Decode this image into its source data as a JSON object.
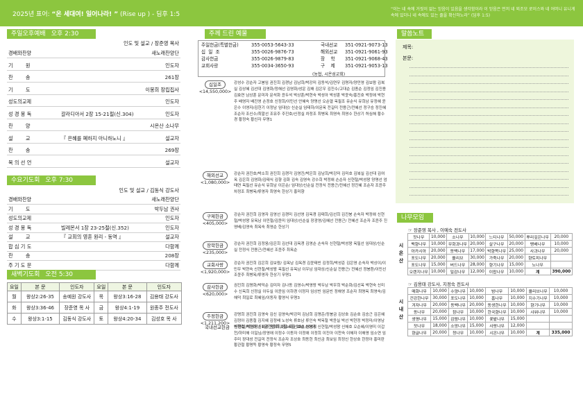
{
  "top": {
    "year_motto_prefix": "2025년 표어: ",
    "motto": "“온 세대여! 일어나라! ”",
    "motto_sub": " (Rise up ) - 딤후 1:5",
    "verse": "“이는 네 속에 거짓이 없는 믿음이 있음을 생각함이라 이 믿음은 먼저 네 외조모 로이스와 네 어머니 유니게 속에 있더니 네 속에도 있는 줄을 확신하노라” (딤후 1:5)"
  },
  "sunday": {
    "title": "주일오후예배",
    "time": "오후 2:30",
    "leader": "인도 및 설교 / 장준영 목사",
    "rows": [
      {
        "k": "경배와찬양",
        "m": "",
        "v": "새노래찬양단"
      },
      {
        "k": "기        원",
        "m": "",
        "v": "인도자"
      },
      {
        "k": "찬        송",
        "m": "",
        "v": "261장"
      },
      {
        "k": "기        도",
        "m": "",
        "v": "이봉희 장립집사"
      },
      {
        "k": "성도의교제",
        "m": "",
        "v": "인도자"
      },
      {
        "k": "성 경 봉 독",
        "m": "갈라디아서 2장 15-21절(신.304)",
        "v": "인도자"
      },
      {
        "k": "찬        양",
        "m": "",
        "v": "시온산 소나무"
      },
      {
        "k": "설        교",
        "m": "『 은혜를 폐하지 아니하노니 』",
        "v": "설교자"
      },
      {
        "k": "찬        송",
        "m": "",
        "v": "269장"
      },
      {
        "k": "복 의 선 언",
        "m": "",
        "v": "설교자"
      }
    ]
  },
  "wednesday": {
    "title": "수요기도회",
    "time": "오후 7:30",
    "leader": "인도 및 설교 / 김동식 강도사",
    "rows": [
      {
        "k": "경배와찬양",
        "m": "",
        "v": "새노래찬양단"
      },
      {
        "k": "기        도",
        "m": "",
        "v": "박두남 권사"
      },
      {
        "k": "성도의교제",
        "m": "",
        "v": "인도자"
      },
      {
        "k": "성 경 봉 독",
        "m": "빌레몬서 1장 23-25절(신.352)",
        "v": "인도자"
      },
      {
        "k": "설        교",
        "m": "『 교회의 영혼 원리 - 동역 』",
        "v": "설교자"
      },
      {
        "k": "합 심 기 도",
        "m": "",
        "v": "다함께"
      },
      {
        "k": "찬        송",
        "m": "",
        "v": "208장"
      },
      {
        "k": "주 기 도 문",
        "m": "",
        "v": "다함께"
      }
    ]
  },
  "dawn": {
    "title": "새벽기도회",
    "time": "오전 5:30",
    "head": [
      "요일",
      "본    문",
      "인도자",
      "요일",
      "본    문",
      "인도자"
    ],
    "rows": [
      [
        "월",
        "왕상2:26-35",
        "송예원 강도사",
        "목",
        "왕상3:16-28",
        "김용태 강도사"
      ],
      [
        "화",
        "왕상3:36-46",
        "장준영 목 사",
        "금",
        "왕상4:1-19",
        "원종주 전도사"
      ],
      [
        "수",
        "왕상3:1-15",
        "김동식 강도사",
        "토",
        "왕상4:20-34",
        "김성호 목 사"
      ]
    ]
  },
  "offering": {
    "title": "주께 드린 예물",
    "accounts": [
      {
        "k": "주일헌금(특별헌금)",
        "v": "355-0053-5643-33",
        "k2": "국내선교",
        "v2": "351-0921-9073-13"
      },
      {
        "k": "십  일  조",
        "v": "355-0026-9876-73",
        "k2": "해외선교",
        "v2": "351-0921-9061-93"
      },
      {
        "k": "감사헌금",
        "v": "355-0026-9879-83",
        "k2": "장    학",
        "v2": "351-0921-9068-43"
      },
      {
        "k": "교회사랑",
        "v": "355-0034-3650-93",
        "k2": "구    제",
        "v2": "351-0921-9053-13"
      }
    ],
    "bank": "(농협, 시온성교회)",
    "cats": [
      {
        "name": "십일조",
        "amt": "<14,550,000>",
        "names": "강성수 강순자 고봉임 권진희 김경남 김남희/박강미 김동석/김연우 김명자/양민영 김보람 김복실 김상혜 김선대 김영화/정해선 김영화/성운 김해 김은우 김진수/고대순 김종순 김정임 김진용 김효연 남상훈 문미자 문석화 윤두석 박상훈/박현숙 박성아 박성훈 박윤숙/홍진호 박정애 박현주 배영자 배진영 손정호 신정희/이민선 안혜숙 양명선 오순열 옥필조 유순식 유희남 유정혜 윤은수 이영자/김헌기 이정남 임대상/ 신순실 임태하/이문옥 전길미 전용근/전혜선 정구승 정진혜 조순자 조신수/최말선 조유주 주진호/신정실 차정조 최병옥 최영숙 최영수 한상기 허심해 황수경 황정숙 황신자 무명1",
        "lines": 14
      },
      {
        "name": "해외선교",
        "amt": "<1,080,000>",
        "names": "강순자 권진호/박소희 권진희 김경각 김영진/박은희 김남희/박강미 김미호 김복실 김선대 김여옥 김은희 김영화/김태식 김향 김화 김숙 김영숙 강수희 박정애 손순자 신현철/박성왕 양명선 엄태연 옥필선 유순식 유희남 이은순/ 임대상/신순실 전정식 전용근/전혜선 정진혜 조순자 조윤주 차정조 최병옥/류영자 최영숙 한상기 홍미향",
        "lines": 6
      },
      {
        "name": "구제헌금",
        "amt": "<405,000>",
        "names": "강순자 권진희 김영자 김영선 김경미 김선영 김옥경 김태희/김선희 김진봉 손숙자 박정애 신현철/박성왕 유옥남 이민철/김윤미 임대상/신순실 장광영/김혜선 전용근/ 전혜선 조순자 조윤주 진영배/김영숙 최옥숙 최영순 한상기",
        "lines": 4
      },
      {
        "name": "장학헌금",
        "amt": "<235,000>",
        "names": "강순자 권진희 김정웅/김은희 김선대 김옥경 김영순 손숙자 신현철/박성왕 옥필선 임대상/신순실 전정식 전용근/전혜선 조윤주 최옥순",
        "lines": 2
      },
      {
        "name": "교회사랑",
        "amt": "<1,920,000>",
        "names": "강순자 권진희 김은희 김보람/ 김옥남 김옥경 김윤태빈 김정희/박성준 김은영 손숙자 박상이/이민우 박현숙 신현철/박성왕 옥필선 유옥남 이우남 임대상/신순실 전용근/ 전혜선 정봉환/이민선 조윤주 최병옥/류영자 한상기 무명1",
        "lines": 3
      },
      {
        "name": "감사헌금",
        "amt": "<620,000>",
        "names": "권진희 김명화/박덕순 김미자 김나동 김영수/박영랑 박두남 박우희 박순화/김선옥 박현숙 신미수 신옥희 신정실 이두실 이윤임 이하경 이정자 임상빈 임문빈 정해영 조순자 최명옥 최영숙/김해덕 최일로 최혜임/이동자 황영식 무명3",
        "lines": 4
      },
      {
        "name": "주정헌금",
        "amt": "<1,211,200>",
        "names": "강명희 권진희 김영숙 김신 김영숙/박강미 김남희 김명준/정봉금 김상호 김순호 김승근 김은혜 김정아 김종철 김지혜 김정배 노성숙 류호남 류인숙 박옥철 박윤실 박선 박현정 박정미/이영남 박정호 박현주 손숙자 송대희/정소희 선효순 신민제 신현철/박성왕 신해호 오순혜/이영미 이갑천/하미해 이일님/장영애 이정수 이동자 이정애 이정희 이진아 이찬숙 이해자 이해영 임소연 임주미 장대성 전길미 전정식 조순자 조상호 최동헌 최신금 최보임 최정신 한상호 한정아 홍미란 황관철 황명득 황영숙 황정숙 무명5",
        "lines": 7
      }
    ],
    "domestic": {
      "name": "국내선교헌금",
      "names": "신현철/박성왕 [1달연합회 1월-6월 180,000]"
    }
  },
  "memo": {
    "title": "말씀노트",
    "l1": "제목:",
    "l2": "본문:"
  },
  "tree": {
    "title": "나무모임",
    "g1": {
      "side": "시온산",
      "head": "☞ 장준영 목사 , 이예숙 전도사",
      "rows": [
        [
          "잣나무",
          "10,000",
          "소나무",
          "10,000",
          "느티나무",
          "50,000",
          "뿌리깊은나무",
          "20,000"
        ],
        [
          "백향나무",
          "10,000",
          "무화과나무",
          "20,000",
          "살구나무",
          "20,000",
          "팽배나무",
          "10,000"
        ],
        [
          "아카시아",
          "20,000",
          "동백나무",
          "17,000",
          "박향목나무",
          "25,000",
          "사과나무",
          "20,000"
        ],
        [
          "포도나무",
          "20,000",
          "올리브",
          "30,000",
          "가죽나무",
          "20,000",
          "향토피나무",
          ""
        ],
        [
          "포도나무",
          "15,000",
          "버드나무",
          "28,000",
          "향기나무",
          "15,000",
          "노나무",
          ""
        ],
        [
          "오렌지나무",
          "10,000",
          "밀감나무",
          "12,000",
          "이팝나무",
          "10,000",
          "계",
          "390,000"
        ]
      ]
    },
    "g2": {
      "side": "시내산",
      "head": "☞ 김용태 강도사, 지정숙 전도사",
      "rows": [
        [
          "매화나무",
          "10,000",
          "수양나무",
          "10,000",
          "밤나무",
          "10,000",
          "올리브나무",
          "10,000"
        ],
        [
          "건강한나무",
          "30,000",
          "포도나무",
          "10,000",
          "흠나무",
          "10,000",
          "지수기나무",
          "10,000"
        ],
        [
          "겨자나무",
          "20,000",
          "동백나무",
          "20,000",
          "동생한나무",
          "10,000",
          "향기나무",
          "10,000"
        ],
        [
          "동나무",
          "20,000",
          "참나무",
          "10,000",
          "한국향나무",
          "10,000",
          "샤워나무",
          "10,000"
        ],
        [
          "생명나무",
          "15,000",
          "감람나무",
          "10,000",
          "꽃밭나무",
          "15,000",
          "",
          ""
        ],
        [
          "잣나무",
          "18,000",
          "소망나무",
          "15,000",
          "사랑나무",
          "12,000",
          "",
          ""
        ],
        [
          "향글나무",
          "20,000",
          "청나무",
          "10,000",
          "시온나무",
          "10,000",
          "계",
          "335,000"
        ]
      ]
    }
  }
}
